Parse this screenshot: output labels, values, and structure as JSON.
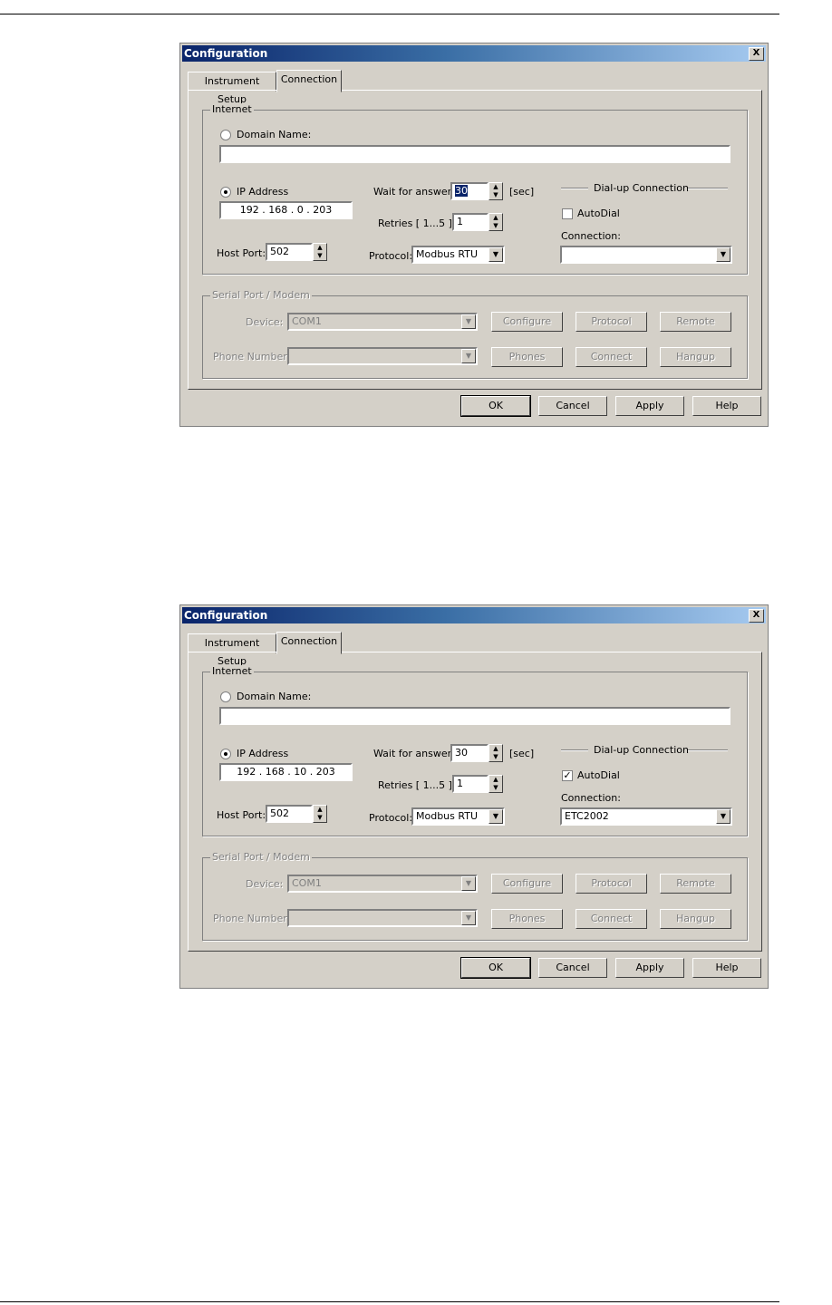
{
  "dialogs": [
    {
      "title": "Configuration",
      "close_label": "X",
      "tabs": [
        "Instrument Setup",
        "Connection"
      ],
      "internet": {
        "legend": "Internet",
        "domain_name_label": "Domain Name:",
        "domain_name_value": "",
        "ip_address_label": "IP Address",
        "ip_address_value": "192 . 168 . 0 . 203",
        "host_port_label": "Host Port:",
        "host_port_value": "502",
        "wait_label": "Wait for answer:",
        "wait_value": "30",
        "wait_unit": "[sec]",
        "retries_label": "Retries [ 1...5 ]:",
        "retries_value": "1",
        "protocol_label": "Protocol:",
        "protocol_value": "Modbus RTU",
        "dialup_heading": "Dial-up Connection",
        "autodial_label": "AutoDial",
        "autodial_checked": false,
        "connection_label": "Connection:",
        "connection_value": ""
      },
      "serial": {
        "legend": "Serial Port / Modem",
        "device_label": "Device:",
        "device_value": "COM1",
        "phone_label": "Phone Number:",
        "phone_value": "",
        "buttons": [
          "Configure",
          "Protocol",
          "Remote",
          "Phones",
          "Connect",
          "Hangup"
        ]
      },
      "footer_buttons": [
        "OK",
        "Cancel",
        "Apply",
        "Help"
      ]
    },
    {
      "title": "Configuration",
      "close_label": "X",
      "tabs": [
        "Instrument Setup",
        "Connection"
      ],
      "internet": {
        "legend": "Internet",
        "domain_name_label": "Domain Name:",
        "domain_name_value": "",
        "ip_address_label": "IP Address",
        "ip_address_value": "192 . 168 . 10 . 203",
        "host_port_label": "Host Port:",
        "host_port_value": "502",
        "wait_label": "Wait for answer:",
        "wait_value": "30",
        "wait_unit": "[sec]",
        "retries_label": "Retries [ 1...5 ]:",
        "retries_value": "1",
        "protocol_label": "Protocol:",
        "protocol_value": "Modbus RTU",
        "dialup_heading": "Dial-up Connection",
        "autodial_label": "AutoDial",
        "autodial_checked": true,
        "connection_label": "Connection:",
        "connection_value": "ETC2002"
      },
      "serial": {
        "legend": "Serial Port / Modem",
        "device_label": "Device:",
        "device_value": "COM1",
        "phone_label": "Phone Number:",
        "phone_value": "",
        "buttons": [
          "Configure",
          "Protocol",
          "Remote",
          "Phones",
          "Connect",
          "Hangup"
        ]
      },
      "footer_buttons": [
        "OK",
        "Cancel",
        "Apply",
        "Help"
      ]
    }
  ]
}
